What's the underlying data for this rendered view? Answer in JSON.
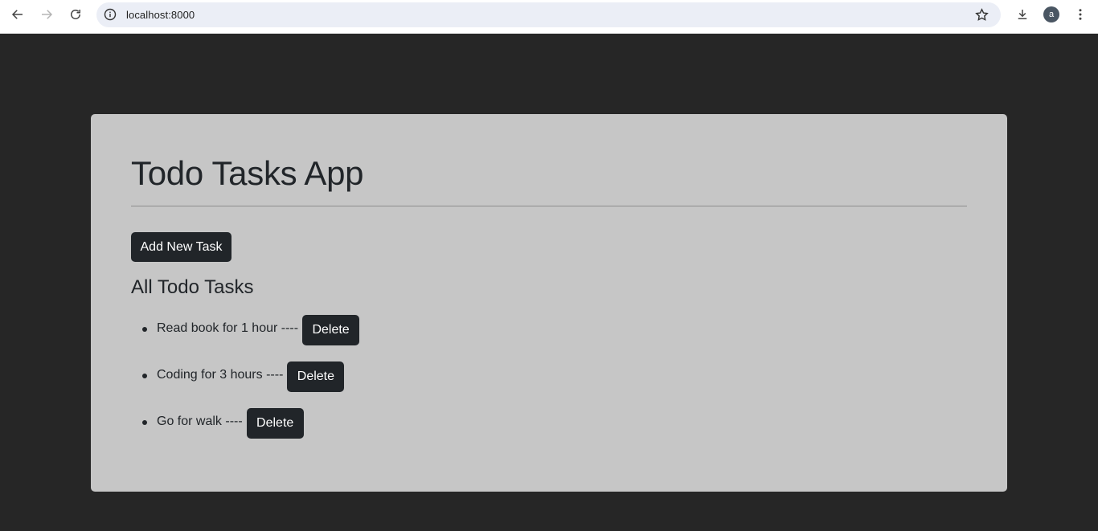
{
  "browser": {
    "url": "localhost:8000",
    "profile_initial": "a",
    "icons": [
      "back-icon",
      "forward-icon",
      "reload-icon",
      "info-icon",
      "star-icon",
      "download-icon",
      "kebab-menu-icon"
    ]
  },
  "app": {
    "title": "Todo Tasks App",
    "add_button_label": "Add New Task",
    "list_heading": "All Todo Tasks",
    "tasks": [
      {
        "text": "Read book for 1 hour ----",
        "delete_label": "Delete"
      },
      {
        "text": "Coding for 3 hours ----",
        "delete_label": "Delete"
      },
      {
        "text": "Go for walk ----",
        "delete_label": "Delete"
      }
    ]
  },
  "colors": {
    "page_background": "#262626",
    "card_background": "#c6c6c6",
    "button_background": "#212529",
    "text": "#212529"
  }
}
